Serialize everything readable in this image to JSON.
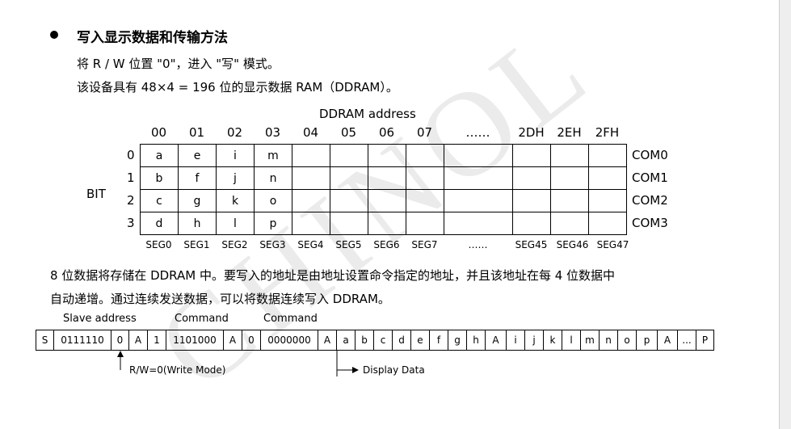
{
  "watermark": "CHINOL",
  "section": {
    "heading": "写入显示数据和传输方法",
    "line1": "将 R / W 位置 \"0\"，进入 \"写\" 模式。",
    "line2": "该设备具有 48×4 = 196 位的显示数据 RAM（DDRAM）。"
  },
  "ddram": {
    "title": "DDRAM address",
    "addresses": [
      "00",
      "01",
      "02",
      "03",
      "04",
      "05",
      "06",
      "07",
      "……",
      "2DH",
      "2EH",
      "2FH"
    ],
    "bit_label": "BIT",
    "bit_rows": [
      "0",
      "1",
      "2",
      "3"
    ],
    "cells": [
      [
        "a",
        "e",
        "i",
        "m",
        "",
        "",
        "",
        "",
        "",
        "",
        "",
        ""
      ],
      [
        "b",
        "f",
        "j",
        "n",
        "",
        "",
        "",
        "",
        "",
        "",
        "",
        ""
      ],
      [
        "c",
        "g",
        "k",
        "o",
        "",
        "",
        "",
        "",
        "",
        "",
        "",
        ""
      ],
      [
        "d",
        "h",
        "l",
        "p",
        "",
        "",
        "",
        "",
        "",
        "",
        "",
        ""
      ]
    ],
    "coms": [
      "COM0",
      "COM1",
      "COM2",
      "COM3"
    ],
    "segs": [
      "SEG0",
      "SEG1",
      "SEG2",
      "SEG3",
      "SEG4",
      "SEG5",
      "SEG6",
      "SEG7",
      "……",
      "SEG45",
      "SEG46",
      "SEG47"
    ]
  },
  "desc": {
    "line1": "8 位数据将存储在 DDRAM 中。要写入的地址是由地址设置命令指定的地址，并且该地址在每 4 位数据中",
    "line2": "自动递增。通过连续发送数据，可以将数据连续写入 DDRAM。"
  },
  "transmission": {
    "label_slave": "Slave address",
    "label_cmd1": "Command",
    "label_cmd2": "Command",
    "cells": [
      "S",
      "0111110",
      "0",
      "A",
      "1",
      "1101000",
      "A",
      "0",
      "0000000",
      "A",
      "a",
      "b",
      "c",
      "d",
      "e",
      "f",
      "g",
      "h",
      "A",
      "i",
      "j",
      "k",
      "l",
      "m",
      "n",
      "o",
      "p",
      "A",
      "...",
      "P"
    ],
    "rw_note": "R/W=0(Write Mode)",
    "display_data": "Display Data"
  }
}
